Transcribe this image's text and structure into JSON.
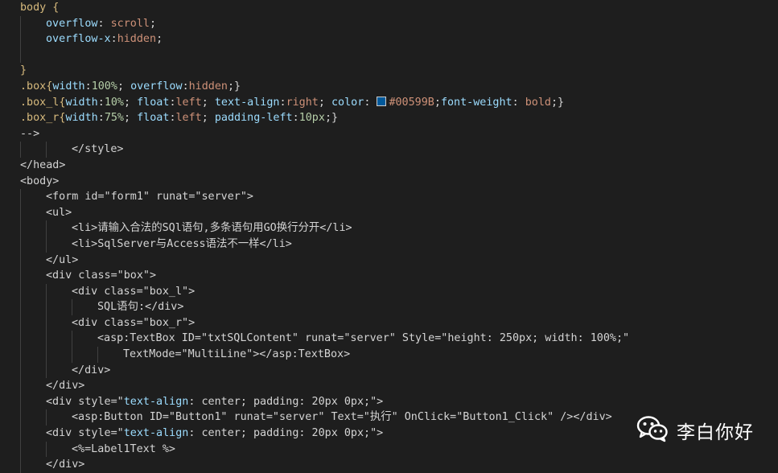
{
  "editor": {
    "background": "#1e1e1e",
    "lines": [
      {
        "indent": 0,
        "tokens": [
          {
            "t": "body {",
            "c": "#d7ba7d"
          }
        ]
      },
      {
        "indent": 1,
        "tokens": [
          {
            "t": "overflow",
            "c": "#9cdcfe"
          },
          {
            "t": ": ",
            "c": "#d4d4d4"
          },
          {
            "t": "scroll",
            "c": "#ce9178"
          },
          {
            "t": ";",
            "c": "#d4d4d4"
          }
        ]
      },
      {
        "indent": 1,
        "tokens": [
          {
            "t": "overflow-x",
            "c": "#9cdcfe"
          },
          {
            "t": ":",
            "c": "#d4d4d4"
          },
          {
            "t": "hidden",
            "c": "#ce9178"
          },
          {
            "t": ";",
            "c": "#d4d4d4"
          }
        ]
      },
      {
        "indent": 1,
        "tokens": []
      },
      {
        "indent": 0,
        "tokens": [
          {
            "t": "}",
            "c": "#d7ba7d"
          }
        ]
      },
      {
        "indent": 0,
        "tokens": [
          {
            "t": ".box{",
            "c": "#d7ba7d"
          },
          {
            "t": "width",
            "c": "#9cdcfe"
          },
          {
            "t": ":",
            "c": "#d4d4d4"
          },
          {
            "t": "100%",
            "c": "#b5cea8"
          },
          {
            "t": "; ",
            "c": "#d4d4d4"
          },
          {
            "t": "overflow",
            "c": "#9cdcfe"
          },
          {
            "t": ":",
            "c": "#d4d4d4"
          },
          {
            "t": "hidden",
            "c": "#ce9178"
          },
          {
            "t": ";}",
            "c": "#d4d4d4"
          }
        ]
      },
      {
        "indent": 0,
        "tokens": [
          {
            "t": ".box_l{",
            "c": "#d7ba7d"
          },
          {
            "t": "width",
            "c": "#9cdcfe"
          },
          {
            "t": ":",
            "c": "#d4d4d4"
          },
          {
            "t": "10%",
            "c": "#b5cea8"
          },
          {
            "t": "; ",
            "c": "#d4d4d4"
          },
          {
            "t": "float",
            "c": "#9cdcfe"
          },
          {
            "t": ":",
            "c": "#d4d4d4"
          },
          {
            "t": "left",
            "c": "#ce9178"
          },
          {
            "t": "; ",
            "c": "#d4d4d4"
          },
          {
            "t": "text-align",
            "c": "#9cdcfe"
          },
          {
            "t": ":",
            "c": "#d4d4d4"
          },
          {
            "t": "right",
            "c": "#ce9178"
          },
          {
            "t": "; ",
            "c": "#d4d4d4"
          },
          {
            "t": "color",
            "c": "#9cdcfe"
          },
          {
            "t": ": ",
            "c": "#d4d4d4"
          },
          {
            "swatch": "#00599B"
          },
          {
            "t": "#00599B",
            "c": "#ce9178"
          },
          {
            "t": ";",
            "c": "#d4d4d4"
          },
          {
            "t": "font-weight",
            "c": "#9cdcfe"
          },
          {
            "t": ": ",
            "c": "#d4d4d4"
          },
          {
            "t": "bold",
            "c": "#ce9178"
          },
          {
            "t": ";}",
            "c": "#d4d4d4"
          }
        ]
      },
      {
        "indent": 0,
        "tokens": [
          {
            "t": ".box_r{",
            "c": "#d7ba7d"
          },
          {
            "t": "width",
            "c": "#9cdcfe"
          },
          {
            "t": ":",
            "c": "#d4d4d4"
          },
          {
            "t": "75%",
            "c": "#b5cea8"
          },
          {
            "t": "; ",
            "c": "#d4d4d4"
          },
          {
            "t": "float",
            "c": "#9cdcfe"
          },
          {
            "t": ":",
            "c": "#d4d4d4"
          },
          {
            "t": "left",
            "c": "#ce9178"
          },
          {
            "t": "; ",
            "c": "#d4d4d4"
          },
          {
            "t": "padding-left",
            "c": "#9cdcfe"
          },
          {
            "t": ":",
            "c": "#d4d4d4"
          },
          {
            "t": "10px",
            "c": "#b5cea8"
          },
          {
            "t": ";}",
            "c": "#d4d4d4"
          }
        ]
      },
      {
        "indent": 0,
        "tokens": [
          {
            "t": "-->",
            "c": "#d4d4d4"
          }
        ]
      },
      {
        "indent": 2,
        "tokens": [
          {
            "t": "</style>",
            "c": "#d4d4d4"
          }
        ]
      },
      {
        "indent": 0,
        "tokens": [
          {
            "t": "</head>",
            "c": "#d4d4d4"
          }
        ]
      },
      {
        "indent": 0,
        "tokens": [
          {
            "t": "<body>",
            "c": "#d4d4d4"
          }
        ]
      },
      {
        "indent": 1,
        "tokens": [
          {
            "t": "<form id=\"form1\" runat=\"server\">",
            "c": "#d4d4d4"
          }
        ]
      },
      {
        "indent": 1,
        "tokens": [
          {
            "t": "<ul>",
            "c": "#d4d4d4"
          }
        ]
      },
      {
        "indent": 2,
        "tokens": [
          {
            "t": "<li>请输入合法的SQl语句,多条语句用GO换行分开</li>",
            "c": "#d4d4d4"
          }
        ]
      },
      {
        "indent": 2,
        "tokens": [
          {
            "t": "<li>SqlServer与Access语法不一样</li>",
            "c": "#d4d4d4"
          }
        ]
      },
      {
        "indent": 1,
        "tokens": [
          {
            "t": "</ul>",
            "c": "#d4d4d4"
          }
        ]
      },
      {
        "indent": 1,
        "tokens": [
          {
            "t": "<div class=\"box\">",
            "c": "#d4d4d4"
          }
        ]
      },
      {
        "indent": 2,
        "tokens": [
          {
            "t": "<div class=\"box_l\">",
            "c": "#d4d4d4"
          }
        ]
      },
      {
        "indent": 3,
        "tokens": [
          {
            "t": "SQL语句:</div>",
            "c": "#d4d4d4"
          }
        ]
      },
      {
        "indent": 2,
        "tokens": [
          {
            "t": "<div class=\"box_r\">",
            "c": "#d4d4d4"
          }
        ]
      },
      {
        "indent": 3,
        "tokens": [
          {
            "t": "<asp:TextBox ID=\"txtSQLContent\" runat=\"server\" Style=\"height: 250px; width: 100%;\"",
            "c": "#d4d4d4"
          }
        ]
      },
      {
        "indent": 4,
        "tokens": [
          {
            "t": "TextMode=\"MultiLine\"></asp:TextBox>",
            "c": "#d4d4d4"
          }
        ]
      },
      {
        "indent": 2,
        "tokens": [
          {
            "t": "</div>",
            "c": "#d4d4d4"
          }
        ]
      },
      {
        "indent": 1,
        "tokens": [
          {
            "t": "</div>",
            "c": "#d4d4d4"
          }
        ]
      },
      {
        "indent": 1,
        "tokens": [
          {
            "t": "<div style=\"",
            "c": "#d4d4d4"
          },
          {
            "t": "text-align",
            "c": "#9cdcfe"
          },
          {
            "t": ": center; padding: 20px 0px;\">",
            "c": "#d4d4d4"
          }
        ]
      },
      {
        "indent": 2,
        "tokens": [
          {
            "t": "<asp:Button ID=\"Button1\" runat=\"server\" Text=\"执行\" OnClick=\"Button1_Click\" /></div>",
            "c": "#d4d4d4"
          }
        ]
      },
      {
        "indent": 1,
        "tokens": [
          {
            "t": "<div style=\"",
            "c": "#d4d4d4"
          },
          {
            "t": "text-align",
            "c": "#9cdcfe"
          },
          {
            "t": ": center; padding: 20px 0px;\">",
            "c": "#d4d4d4"
          }
        ]
      },
      {
        "indent": 2,
        "tokens": [
          {
            "t": "<%=Label1Text %>",
            "c": "#d4d4d4"
          }
        ]
      },
      {
        "indent": 1,
        "tokens": [
          {
            "t": "</div>",
            "c": "#d4d4d4"
          }
        ]
      }
    ]
  },
  "watermark": {
    "text": "李白你好",
    "icon": "wechat-icon"
  }
}
